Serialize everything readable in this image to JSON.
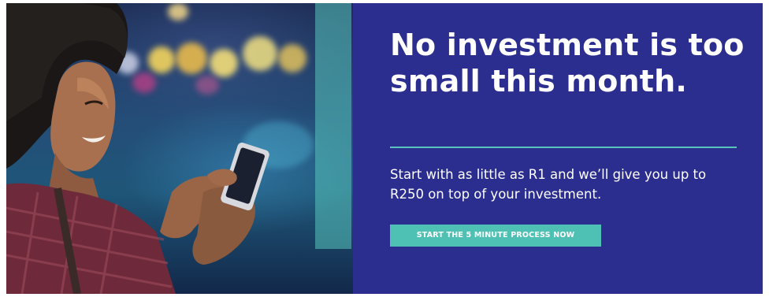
{
  "banner": {
    "headline": "No investment is too small this month.",
    "subtext": "Start with as little as R1 and we’ll give you up to R250 on top of your investment.",
    "cta_label": "START THE 5 MINUTE PROCESS NOW"
  },
  "colors": {
    "panel_background": "#2b2e8f",
    "accent_teal": "#4ec1b4",
    "text": "#ffffff"
  },
  "image": {
    "subject": "woman-smiling-using-smartphone-photo"
  }
}
